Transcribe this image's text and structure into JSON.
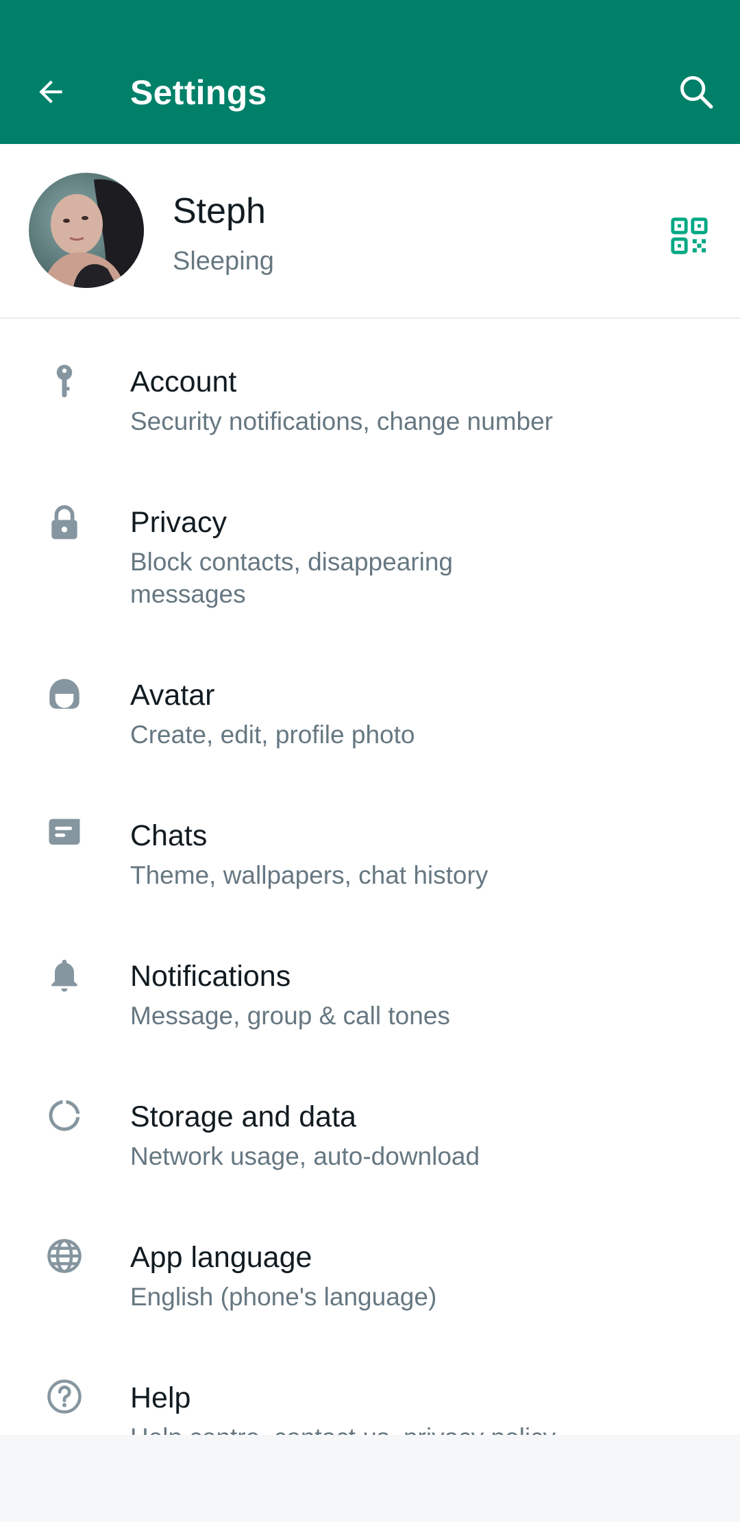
{
  "appbar": {
    "title": "Settings",
    "back_icon": "arrow-left-icon",
    "search_icon": "search-icon",
    "color": "#008069"
  },
  "profile": {
    "name": "Steph",
    "status": "Sleeping",
    "qr_icon": "qr-code-icon",
    "qr_color": "#00a884"
  },
  "settings": [
    {
      "label": "Account",
      "desc": "Security notifications, change number",
      "icon": "key-icon"
    },
    {
      "label": "Privacy",
      "desc": "Block contacts, disappearing messages",
      "icon": "lock-icon"
    },
    {
      "label": "Avatar",
      "desc": "Create, edit, profile photo",
      "icon": "avatar-face-icon"
    },
    {
      "label": "Chats",
      "desc": "Theme, wallpapers, chat history",
      "icon": "chat-icon"
    },
    {
      "label": "Notifications",
      "desc": "Message, group & call tones",
      "icon": "bell-icon"
    },
    {
      "label": "Storage and data",
      "desc": "Network usage, auto-download",
      "icon": "data-usage-icon"
    },
    {
      "label": "App language",
      "desc": "English (phone's language)",
      "icon": "globe-icon"
    },
    {
      "label": "Help",
      "desc": "Help centre, contact us, privacy policy",
      "icon": "help-icon"
    }
  ],
  "colors": {
    "primary_text": "#111b21",
    "secondary_text": "#667781",
    "icon_gray": "#8696a0"
  }
}
